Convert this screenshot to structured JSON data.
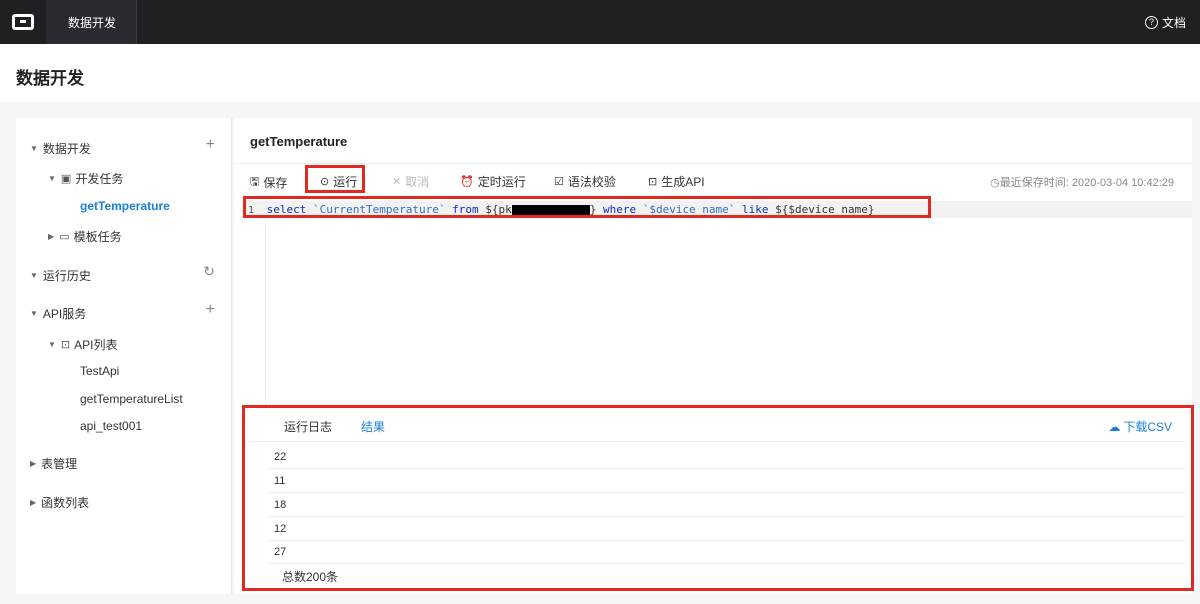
{
  "topbar": {
    "product": "数据开发",
    "docs_label": "文档"
  },
  "page": {
    "title": "数据开发"
  },
  "sidebar": {
    "items": [
      {
        "label": "数据开发",
        "action": "+"
      },
      {
        "label": "开发任务"
      },
      {
        "label": "getTemperature"
      },
      {
        "label": "模板任务"
      },
      {
        "label": "运行历史",
        "action": "↻"
      },
      {
        "label": "API服务",
        "action": "+"
      },
      {
        "label": "API列表"
      },
      {
        "label": "TestApi"
      },
      {
        "label": "getTemperatureList"
      },
      {
        "label": "api_test001"
      },
      {
        "label": "表管理"
      },
      {
        "label": "函数列表"
      }
    ]
  },
  "main": {
    "title": "getTemperature",
    "toolbar": {
      "save": "保存",
      "run": "运行",
      "cancel": "取消",
      "schedule": "定时运行",
      "check": "语法校验",
      "gen_api": "生成API",
      "saved_time": "最近保存时间: 2020-03-04 10:42:29"
    },
    "editor": {
      "line_no": "1",
      "tokens": {
        "select": "select",
        "col": "`CurrentTemperature`",
        "from": "from",
        "table_pre": "${pk",
        "table_post": "}",
        "where": "where",
        "field": "`$device_name`",
        "like": "like",
        "param": "${$device_name}"
      }
    },
    "results": {
      "tab_log": "运行日志",
      "tab_result": "结果",
      "download": "下载CSV",
      "rows": [
        "22",
        "11",
        "18",
        "12",
        "27"
      ],
      "total": "总数200条"
    }
  },
  "colors": {
    "accent": "#1a7fd6",
    "highlight": "#e02a21",
    "topbar": "#1f2024"
  }
}
